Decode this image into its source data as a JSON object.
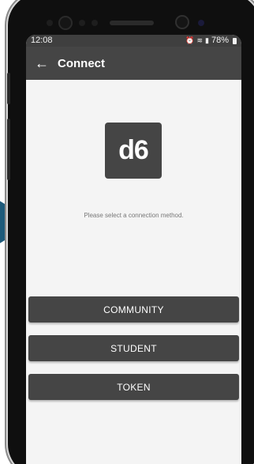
{
  "status_bar": {
    "time": "12:08",
    "alarm_icon": "alarm-icon",
    "wifi_icon": "wifi-icon",
    "signal_icon": "signal-icon",
    "battery_icon": "battery-icon",
    "battery": "78%"
  },
  "app_bar": {
    "back_icon": "arrow-left-icon",
    "back_glyph": "←",
    "title": "Connect",
    "color": "#454545"
  },
  "logo": {
    "text": "d6"
  },
  "prompt": "Please select a connection method.",
  "buttons": {
    "community": "COMMUNITY",
    "student": "STUDENT",
    "token": "TOKEN"
  },
  "colors": {
    "accent_arrow": "#1d5a7a",
    "button": "#454545",
    "background": "#f4f4f4"
  }
}
